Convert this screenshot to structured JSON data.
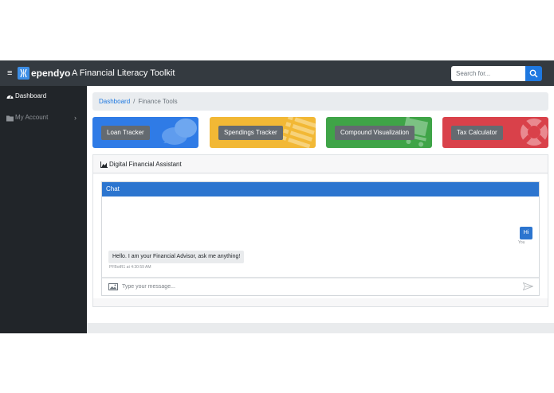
{
  "navbar": {
    "brand": "ependyo",
    "tagline": "A Financial Literacy Toolkit",
    "search_placeholder": "Search for..."
  },
  "sidebar": {
    "items": [
      {
        "label": "Dashboard",
        "icon": "tachometer-icon",
        "active": true
      },
      {
        "label": "My Account",
        "icon": "folder-icon",
        "active": false
      }
    ]
  },
  "breadcrumb": {
    "link": "Dashboard",
    "separator": "/",
    "current": "Finance Tools"
  },
  "cards": [
    {
      "label": "Loan Tracker",
      "color": "#2f7be6",
      "icon": "chat-bubbles-icon"
    },
    {
      "label": "Spendings Tracker",
      "color": "#f2b835",
      "icon": "list-icon"
    },
    {
      "label": "Compound Visualization",
      "color": "#3fa447",
      "icon": "cart-icon"
    },
    {
      "label": "Tax Calculator",
      "color": "#d9414a",
      "icon": "life-ring-icon"
    }
  ],
  "assistant": {
    "title": "Digital Financial Assistant",
    "chat_title": "Chat",
    "user_message": "Hi",
    "user_meta": "You",
    "bot_message": "Hello. I am your Financial Advisor, ask me anything!",
    "bot_meta": "PFBotR1 at 4:30:59 AM",
    "input_placeholder": "Type your message..."
  },
  "colors": {
    "navbar": "#343a40",
    "sidebar": "#212529",
    "accent": "#1e78e0",
    "chat_header": "#2c75cf"
  }
}
